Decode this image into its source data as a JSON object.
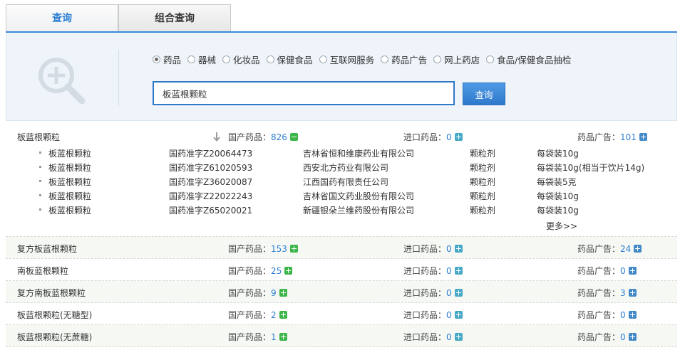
{
  "tabs": [
    {
      "label": "查询",
      "active": true
    },
    {
      "label": "组合查询",
      "active": false
    }
  ],
  "search": {
    "options": [
      {
        "label": "药品",
        "checked": true
      },
      {
        "label": "器械",
        "checked": false
      },
      {
        "label": "化妆品",
        "checked": false
      },
      {
        "label": "保健食品",
        "checked": false
      },
      {
        "label": "互联网服务",
        "checked": false
      },
      {
        "label": "药品广告",
        "checked": false
      },
      {
        "label": "网上药店",
        "checked": false
      },
      {
        "label": "食品/保健食品抽检",
        "checked": false
      }
    ],
    "input_value": "板蓝根颗粒",
    "button_label": "查询"
  },
  "labels": {
    "domestic": "国产药品：",
    "imported": "进口药品：",
    "ads": "药品广告：",
    "more": "更多>>"
  },
  "colors": {
    "accent": "#2d7fd2",
    "plus_green": "#3cb54a",
    "plus_blue": "#4389c8",
    "plus_teal": "#47a9c5"
  },
  "groups": [
    {
      "name": "板蓝根颗粒",
      "domestic": "826",
      "imported": "0",
      "ads": "101",
      "expanded": true,
      "items": [
        {
          "name": "板蓝根颗粒",
          "approval": "国药准字Z20064473",
          "company": "吉林省恒和维康药业有限公司",
          "form": "颗粒剂",
          "spec": "每袋装10g"
        },
        {
          "name": "板蓝根颗粒",
          "approval": "国药准字Z61020593",
          "company": "西安北方药业有限公司",
          "form": "颗粒剂",
          "spec": "每袋装10g(相当于饮片14g)"
        },
        {
          "name": "板蓝根颗粒",
          "approval": "国药准字Z36020087",
          "company": "江西国药有限责任公司",
          "form": "颗粒剂",
          "spec": "每袋装5克"
        },
        {
          "name": "板蓝根颗粒",
          "approval": "国药准字Z22022243",
          "company": "吉林省国文药业股份有限公司",
          "form": "颗粒剂",
          "spec": "每袋装10g"
        },
        {
          "name": "板蓝根颗粒",
          "approval": "国药准字Z65020021",
          "company": "新疆银朵兰维药股份有限公司",
          "form": "颗粒剂",
          "spec": "每袋装10g"
        }
      ]
    },
    {
      "name": "复方板蓝根颗粒",
      "domestic": "153",
      "imported": "0",
      "ads": "24"
    },
    {
      "name": "南板蓝根颗粒",
      "domestic": "25",
      "imported": "0",
      "ads": "0"
    },
    {
      "name": "复方南板蓝根颗粒",
      "domestic": "9",
      "imported": "0",
      "ads": "3"
    },
    {
      "name": "板蓝根颗粒(无糖型)",
      "domestic": "2",
      "imported": "0",
      "ads": "0"
    },
    {
      "name": "板蓝根颗粒(无蔗糖)",
      "domestic": "1",
      "imported": "0",
      "ads": "0"
    }
  ]
}
